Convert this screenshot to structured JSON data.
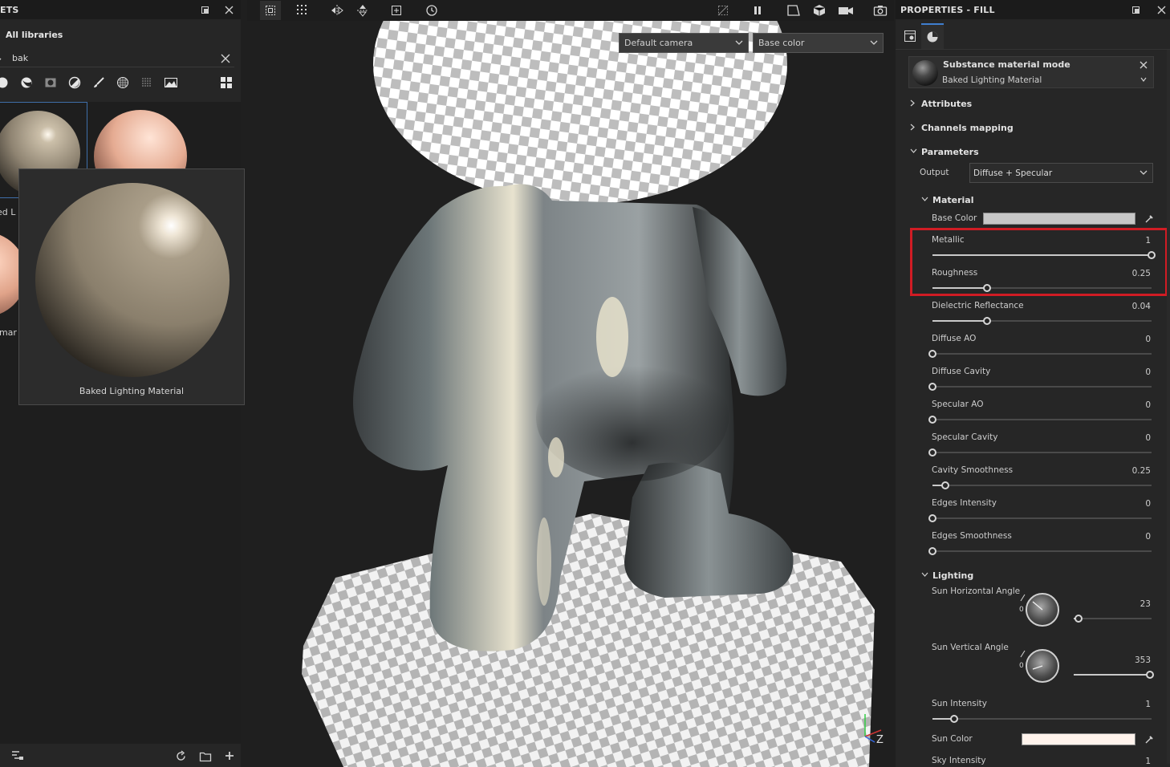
{
  "assets_panel": {
    "title": "ETS",
    "library_label": "All libraries",
    "search_value": "bak",
    "thumb_caption_1": "ked L",
    "thumb_caption_2": "umar",
    "preview_caption": "Baked Lighting Material"
  },
  "viewport": {
    "camera_select": "Default camera",
    "channel_select": "Base color"
  },
  "properties": {
    "title": "PROPERTIES - FILL",
    "material_mode_title": "Substance material mode",
    "material_mode_value": "Baked Lighting Material",
    "sections": {
      "attributes": "Attributes",
      "channels_mapping": "Channels mapping",
      "parameters": "Parameters",
      "material": "Material",
      "lighting": "Lighting"
    },
    "output_label": "Output",
    "output_value": "Diffuse + Specular",
    "base_color_label": "Base Color",
    "params": [
      {
        "label": "Metallic",
        "value": "1",
        "fraction": 1.0
      },
      {
        "label": "Roughness",
        "value": "0.25",
        "fraction": 0.25
      },
      {
        "label": "Dielectric Reflectance",
        "value": "0.04",
        "fraction": 0.25
      },
      {
        "label": "Diffuse AO",
        "value": "0",
        "fraction": 0.0
      },
      {
        "label": "Diffuse Cavity",
        "value": "0",
        "fraction": 0.0
      },
      {
        "label": "Specular AO",
        "value": "0",
        "fraction": 0.0
      },
      {
        "label": "Specular Cavity",
        "value": "0",
        "fraction": 0.0
      },
      {
        "label": "Cavity Smoothness",
        "value": "0.25",
        "fraction": 0.06
      },
      {
        "label": "Edges Intensity",
        "value": "0",
        "fraction": 0.0
      },
      {
        "label": "Edges Smoothness",
        "value": "0",
        "fraction": 0.0
      }
    ],
    "sun_horizontal": {
      "label": "Sun Horizontal Angle",
      "value": "23",
      "dial_zero": "0",
      "fraction": 0.06
    },
    "sun_vertical": {
      "label": "Sun Vertical Angle",
      "value": "353",
      "dial_zero": "0",
      "fraction": 0.98
    },
    "sun_intensity": {
      "label": "Sun Intensity",
      "value": "1",
      "fraction": 0.1
    },
    "sun_color_label": "Sun Color",
    "sky_intensity": {
      "label": "Sky Intensity",
      "value": "1"
    }
  },
  "colors": {
    "highlight": "#d01c24",
    "accent": "#3f7fd0",
    "base_color_swatch": "#c7c7c7",
    "sun_color_swatch": "#fff3ec"
  }
}
